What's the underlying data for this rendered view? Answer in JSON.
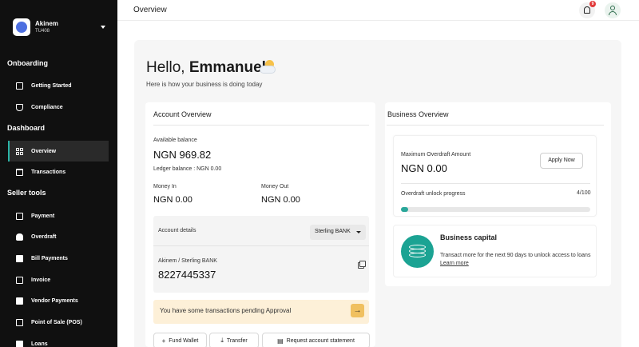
{
  "account": {
    "name": "Akinem",
    "code": "TU408"
  },
  "sidebar": {
    "sections": [
      "Onboarding",
      "Dashboard",
      "Seller tools"
    ],
    "items": [
      {
        "label": "Getting Started",
        "icon": "getting-started-icon"
      },
      {
        "label": "Compliance",
        "icon": "shield-check-icon"
      },
      {
        "label": "Overview",
        "icon": "grid-icon"
      },
      {
        "label": "Transactions",
        "icon": "folder-icon"
      },
      {
        "label": "Payment",
        "icon": "receipt-icon"
      },
      {
        "label": "Overdraft",
        "icon": "cloud-icon"
      },
      {
        "label": "Bill Payments",
        "icon": "bill-icon"
      },
      {
        "label": "Invoice",
        "icon": "invoice-icon"
      },
      {
        "label": "Vendor Payments",
        "icon": "vendor-icon"
      },
      {
        "label": "Point of Sale (POS)",
        "icon": "pos-icon"
      },
      {
        "label": "Loans",
        "icon": "loans-icon"
      }
    ]
  },
  "topbar": {
    "title": "Overview",
    "notification_count": "9"
  },
  "greeting": {
    "hello": "Hello,",
    "name": "Emmanuel",
    "subtitle": "Here is how your business is doing today"
  },
  "account_overview": {
    "title": "Account Overview",
    "available_label": "Available balance",
    "available_value": "NGN 969.82",
    "ledger": "Ledger balance : NGN 0.00",
    "money_in_label": "Money In",
    "money_in_value": "NGN 0.00",
    "money_out_label": "Money Out",
    "money_out_value": "NGN 0.00",
    "details_label": "Account details",
    "bank_select": "Sterling BANK",
    "account_name": "Akinem / Sterling BANK",
    "account_number": "8227445337",
    "pending": "You have some transactions pending Approval",
    "buttons": {
      "fund": "Fund Wallet",
      "transfer": "Transfer",
      "statement": "Request account statement"
    }
  },
  "business_overview": {
    "title": "Business Overview",
    "overdraft_label": "Maximum Overdraft Amount",
    "overdraft_value": "NGN 0.00",
    "apply": "Apply Now",
    "progress_label": "Overdraft unlock progress",
    "progress_text": "4/100",
    "progress_fraction": 0.04,
    "capital_title": "Business capital",
    "capital_text": "Transact more for the next 90 days to unlock access to loans",
    "learn_more": "Learn more"
  },
  "colors": {
    "sidebar_bg": "#101010",
    "accent": "#2aa79a",
    "pending_bg": "#fdf0d8"
  }
}
